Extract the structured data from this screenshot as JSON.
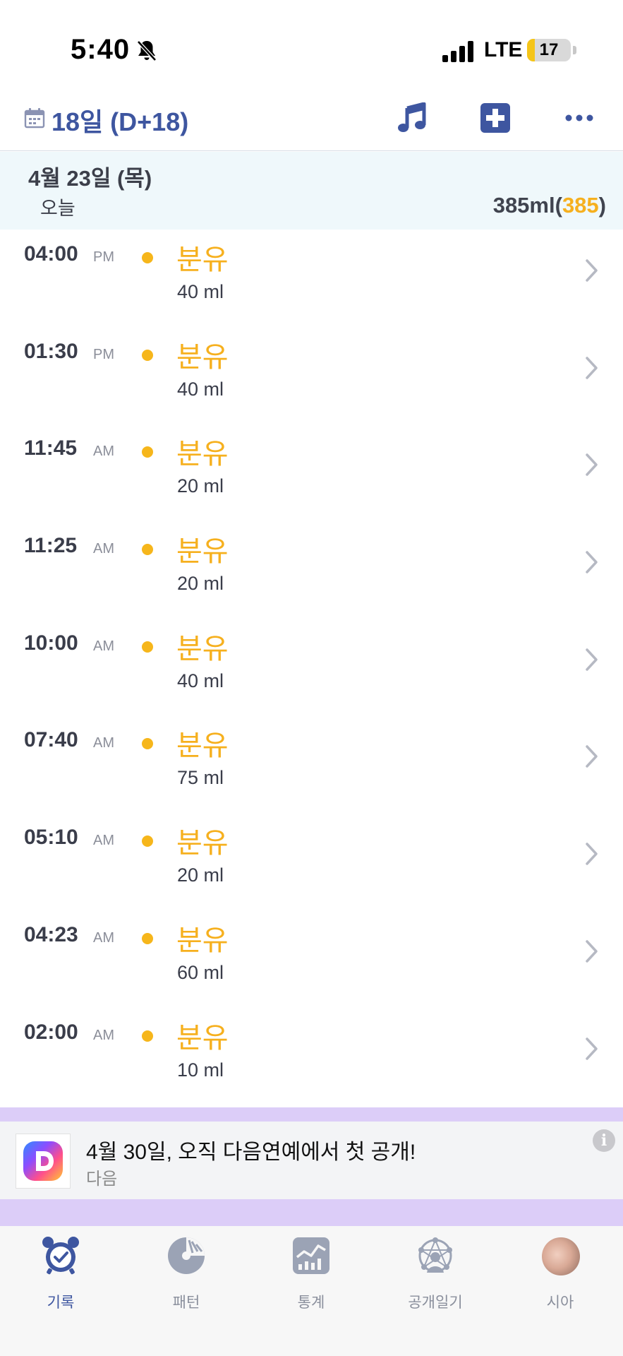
{
  "status_bar": {
    "time": "5:40",
    "network": "LTE",
    "battery": "17",
    "battery_level": 0.17,
    "battery_color": "#f5c518"
  },
  "header": {
    "title": "18일 (D+18)",
    "icons": [
      "calendar-icon",
      "music-icon",
      "plus-icon",
      "more-icon"
    ],
    "accent_color": "#3e56a0"
  },
  "day_summary": {
    "date": "4월 23일 (목)",
    "today": "오늘",
    "total_amount": "385ml",
    "open_paren": "(",
    "total_count": "385",
    "close_paren": ")",
    "highlight_color": "#f6b01e"
  },
  "feeds": [
    {
      "time": "04:00",
      "ampm": "PM",
      "type": "분유",
      "amount": "40 ml"
    },
    {
      "time": "01:30",
      "ampm": "PM",
      "type": "분유",
      "amount": "40 ml"
    },
    {
      "time": "11:45",
      "ampm": "AM",
      "type": "분유",
      "amount": "20 ml"
    },
    {
      "time": "11:25",
      "ampm": "AM",
      "type": "분유",
      "amount": "20 ml"
    },
    {
      "time": "10:00",
      "ampm": "AM",
      "type": "분유",
      "amount": "40 ml"
    },
    {
      "time": "07:40",
      "ampm": "AM",
      "type": "분유",
      "amount": "75 ml"
    },
    {
      "time": "05:10",
      "ampm": "AM",
      "type": "분유",
      "amount": "20 ml"
    },
    {
      "time": "04:23",
      "ampm": "AM",
      "type": "분유",
      "amount": "60 ml"
    },
    {
      "time": "02:00",
      "ampm": "AM",
      "type": "분유",
      "amount": "10 ml"
    }
  ],
  "ad": {
    "title": "4월 30일, 오직 다음연예에서 첫 공개!",
    "source": "다음",
    "info": "i"
  },
  "tabs": [
    {
      "label": "기록",
      "icon": "alarm-clock-icon",
      "active": true
    },
    {
      "label": "패턴",
      "icon": "pattern-chart-icon",
      "active": false
    },
    {
      "label": "통계",
      "icon": "stats-chart-icon",
      "active": false
    },
    {
      "label": "공개일기",
      "icon": "public-diary-icon",
      "active": false
    },
    {
      "label": "시아",
      "icon": "profile-avatar",
      "active": false
    }
  ]
}
